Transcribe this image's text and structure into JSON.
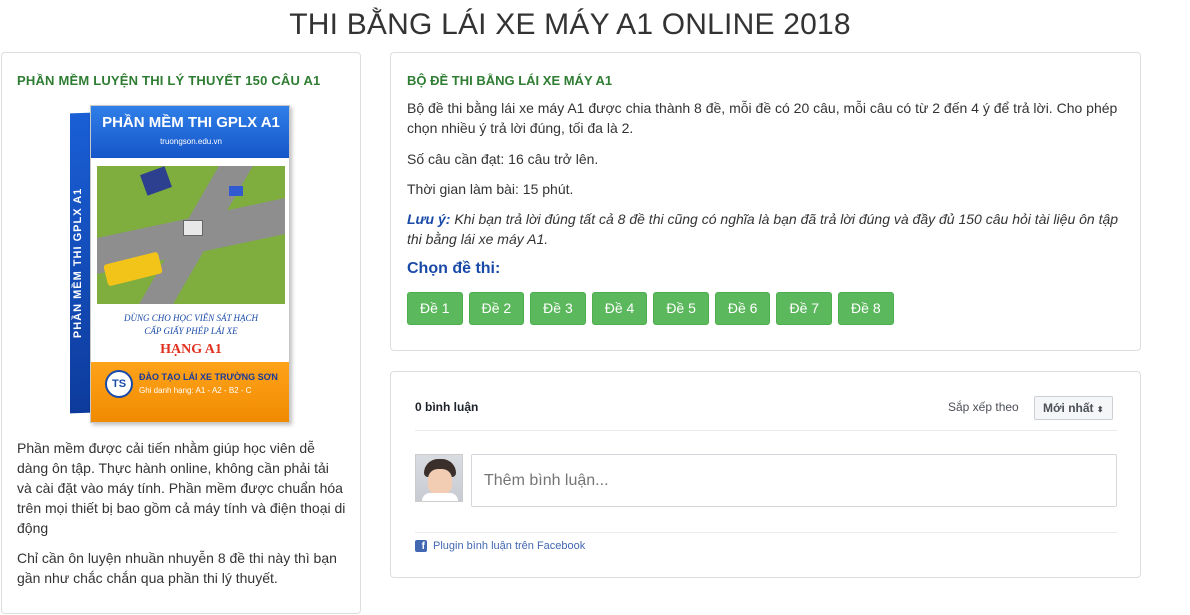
{
  "page": {
    "title": "THI BẰNG LÁI XE MÁY A1 ONLINE 2018"
  },
  "left_panel": {
    "heading": "PHẦN MỀM LUYỆN THI LÝ THUYẾT 150 CÂU A1",
    "box_art": {
      "side_text": "PHẦN MỀM THI GPLX A1",
      "title": "PHẦN MỀM THI GPLX A1",
      "url": "truongson.edu.vn",
      "caption_line1": "DÙNG CHO HỌC VIÊN SÁT HẠCH",
      "caption_line2": "CẤP GIẤY PHÉP LÁI XE",
      "license_class": "HẠNG A1",
      "logo_text": "TS",
      "school": "ĐÀO TẠO LÁI XE TRƯỜNG SƠN",
      "licenses": "Ghi danh hạng: A1 - A2 - B2 - C",
      "colors": {
        "blue": "#1656c9",
        "orange": "#f08a00",
        "red": "#e0301e"
      }
    },
    "description_1": "Phần mềm được cải tiến nhằm giúp học viên dễ dàng ôn tập. Thực hành online, không cần phải tải và cài đặt vào máy tính. Phần mềm được chuẩn hóa trên mọi thiết bị bao gồm cả máy tính và điện thoại di động",
    "description_2": "Chỉ cần ôn luyện nhuần nhuyễn 8 đề thi này thì bạn gần như chắc chắn qua phần thi lý thuyết."
  },
  "exam_panel": {
    "heading": "BỘ ĐỀ THI BẰNG LÁI XE MÁY A1",
    "intro": "Bộ đề thi bằng lái xe máy A1 được chia thành 8 đề, mỗi đề có 20 câu, mỗi câu có từ 2 đến 4 ý để trả lời. Cho phép chọn nhiều ý trả lời đúng, tối đa là 2.",
    "pass": "Số câu cần đạt: 16 câu trở lên.",
    "time": "Thời gian làm bài: 15 phút.",
    "note_label": "Lưu ý:",
    "note_text": " Khi bạn trả lời đúng tất cả 8 đề thi cũng có nghĩa là bạn đã trả lời đúng và đầy đủ 150 câu hỏi tài liệu ôn tập thi bằng lái xe máy A1.",
    "choose_label": "Chọn đề thi:",
    "buttons": [
      "Đề 1",
      "Đề 2",
      "Đề 3",
      "Đề 4",
      "Đề 5",
      "Đề 6",
      "Đề 7",
      "Đề 8"
    ],
    "button_color": "#5cb85c"
  },
  "comments": {
    "count": "0 bình luận",
    "sort_label": "Sắp xếp theo",
    "sort_selected": "Mới nhất",
    "sort_icon": "updown-arrows-icon",
    "input_placeholder": "Thêm bình luận...",
    "facebook_plugin": "Plugin bình luận trên Facebook",
    "facebook_color": "#4267b2"
  }
}
